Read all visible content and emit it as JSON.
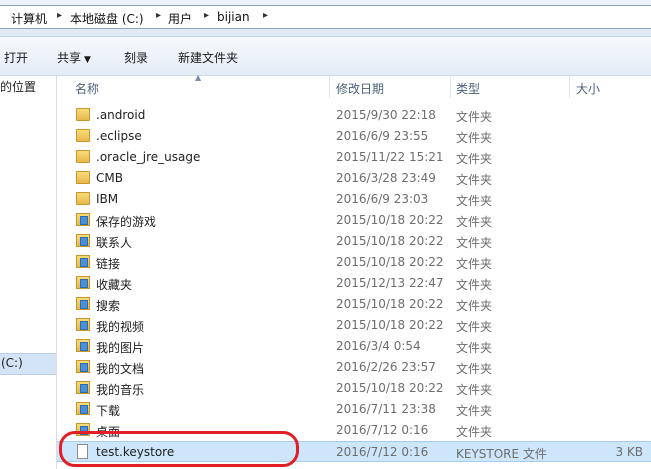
{
  "breadcrumb": [
    "计算机",
    "本地磁盘 (C:)",
    "用户",
    "bijian"
  ],
  "toolbar": {
    "open": "打开",
    "share": "共享",
    "burn": "刻录",
    "new_folder": "新建文件夹"
  },
  "nav": {
    "location_text": "的位置",
    "drive_text": "(C:)"
  },
  "columns": {
    "name": "名称",
    "date": "修改日期",
    "type": "类型",
    "size": "大小"
  },
  "files": [
    {
      "name": ".android",
      "date": "2015/9/30 22:18",
      "type": "文件夹",
      "size": "",
      "icon": "folder-icon"
    },
    {
      "name": ".eclipse",
      "date": "2016/6/9 23:55",
      "type": "文件夹",
      "size": "",
      "icon": "folder-icon"
    },
    {
      "name": ".oracle_jre_usage",
      "date": "2015/11/22 15:21",
      "type": "文件夹",
      "size": "",
      "icon": "folder-icon"
    },
    {
      "name": "CMB",
      "date": "2016/3/28 23:49",
      "type": "文件夹",
      "size": "",
      "icon": "folder-icon"
    },
    {
      "name": "IBM",
      "date": "2016/6/9 23:03",
      "type": "文件夹",
      "size": "",
      "icon": "folder-icon"
    },
    {
      "name": "保存的游戏",
      "date": "2015/10/18 20:22",
      "type": "文件夹",
      "size": "",
      "icon": "saved-games-icon"
    },
    {
      "name": "联系人",
      "date": "2015/10/18 20:22",
      "type": "文件夹",
      "size": "",
      "icon": "contacts-icon"
    },
    {
      "name": "链接",
      "date": "2015/10/18 20:22",
      "type": "文件夹",
      "size": "",
      "icon": "links-icon"
    },
    {
      "name": "收藏夹",
      "date": "2015/12/13 22:47",
      "type": "文件夹",
      "size": "",
      "icon": "favorites-icon"
    },
    {
      "name": "搜索",
      "date": "2015/10/18 20:22",
      "type": "文件夹",
      "size": "",
      "icon": "searches-icon"
    },
    {
      "name": "我的视频",
      "date": "2015/10/18 20:22",
      "type": "文件夹",
      "size": "",
      "icon": "videos-icon"
    },
    {
      "name": "我的图片",
      "date": "2016/3/4 0:54",
      "type": "文件夹",
      "size": "",
      "icon": "pictures-icon"
    },
    {
      "name": "我的文档",
      "date": "2016/2/26 23:57",
      "type": "文件夹",
      "size": "",
      "icon": "documents-icon"
    },
    {
      "name": "我的音乐",
      "date": "2015/10/18 20:22",
      "type": "文件夹",
      "size": "",
      "icon": "music-icon"
    },
    {
      "name": "下载",
      "date": "2016/7/11 23:38",
      "type": "文件夹",
      "size": "",
      "icon": "downloads-icon"
    },
    {
      "name": "桌面",
      "date": "2016/7/12 0:16",
      "type": "文件夹",
      "size": "",
      "icon": "desktop-icon"
    },
    {
      "name": "test.keystore",
      "date": "2016/7/12 0:16",
      "type": "KEYSTORE 文件",
      "size": "3 KB",
      "icon": "file-icon",
      "selected": true
    }
  ],
  "colors": {
    "highlight": "#e21f26",
    "selection": "#cde6fb"
  }
}
